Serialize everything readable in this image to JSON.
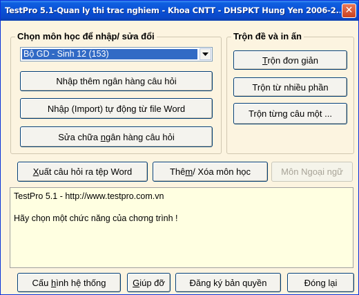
{
  "window": {
    "title": "TestPro 5.1-Quan ly thi trac nghiem - Khoa CNTT - DHSPKT Hung Yen 2006-2...",
    "close_label": "✕"
  },
  "subject_group": {
    "legend": "Chọn môn học để nhập/ sửa đổi",
    "selected_subject": "Bộ GD - Sinh 12 (153)",
    "btn_add_bank_label": "Nhập thêm ngân hàng câu hỏi",
    "btn_import_label": "Nhập (Import) tự động từ file Word",
    "btn_edit_bank_pre": "Sửa chữa ",
    "btn_edit_bank_ul": "n",
    "btn_edit_bank_post": "gân hàng câu hỏi"
  },
  "mix_group": {
    "legend": "Trộn đề và in ấn",
    "btn_simple_ul": "T",
    "btn_simple_post": "rộn đơn giản",
    "btn_multi_label": "Trộn từ nhiều phần",
    "btn_each_label": "Trộn từng câu một ..."
  },
  "middle_row": {
    "btn_export_pre": "X",
    "btn_export_post": "uất câu hỏi ra tệp Word",
    "btn_addremove_pre": "Thê",
    "btn_addremove_ul": "m",
    "btn_addremove_post": "/ Xóa môn học",
    "btn_foreign_label": "Môn Ngoại ngữ"
  },
  "message": {
    "line1": "TestPro 5.1 - http://www.testpro.com.vn",
    "line2": "Hãy chọn một chức năng của chơng trình !"
  },
  "bottom_row": {
    "btn_config_pre": "Cấu ",
    "btn_config_ul": "h",
    "btn_config_post": "ình hệ thống",
    "btn_help_ul": "G",
    "btn_help_post": "iúp đỡ",
    "btn_register_label": "Đăng ký bản quyền",
    "btn_close_label": "Đóng lại"
  },
  "colors": {
    "title_bar": "#0a4fd4",
    "window_bg": "#fcf4e0",
    "message_bg": "#ffffe1",
    "selection": "#316ac5",
    "close_button": "#c9401e"
  },
  "icons": {
    "dropdown": "chevron-down-icon"
  }
}
